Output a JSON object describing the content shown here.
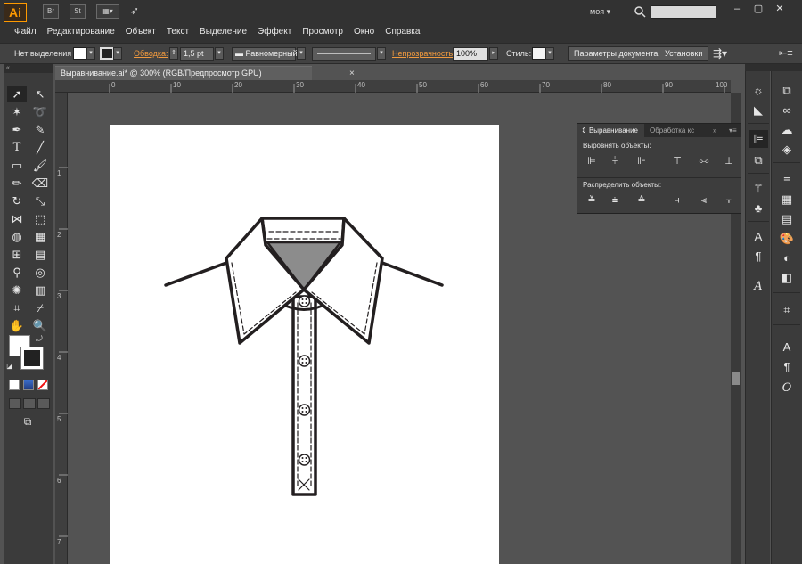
{
  "app": {
    "logo": "Ai",
    "br_label": "Br",
    "st_label": "St",
    "workspace": "моя"
  },
  "menu": [
    "Файл",
    "Редактирование",
    "Объект",
    "Текст",
    "Выделение",
    "Эффект",
    "Просмотр",
    "Окно",
    "Справка"
  ],
  "controlbar": {
    "selection": "Нет выделения",
    "stroke_label": "Обводка:",
    "stroke_value": "1,5 pt",
    "profile": "Равномерный",
    "opacity_label": "Непрозрачность:",
    "opacity_value": "100%",
    "style_label": "Стиль:",
    "doc_settings": "Параметры документа",
    "preferences": "Установки"
  },
  "document": {
    "tab_title": "Выравнивание.ai* @ 300% (RGB/Предпросмотр GPU)",
    "close": "×"
  },
  "rulers": {
    "h_ticks": [
      "0",
      "10",
      "20",
      "30",
      "40",
      "50",
      "60",
      "70",
      "80",
      "90",
      "100"
    ],
    "v_ticks": [
      "1",
      "2",
      "3",
      "4",
      "5",
      "6",
      "7"
    ]
  },
  "align_panel": {
    "tab_active": "Выравнивание",
    "tab_inactive": "Обработка кс",
    "align_objects": "Выровнять объекты:",
    "distribute_objects": "Распределить объекты:"
  },
  "colors": {
    "accent_orange": "#f19a3e",
    "canvas": "#535353",
    "panel": "#3d3d3d"
  }
}
